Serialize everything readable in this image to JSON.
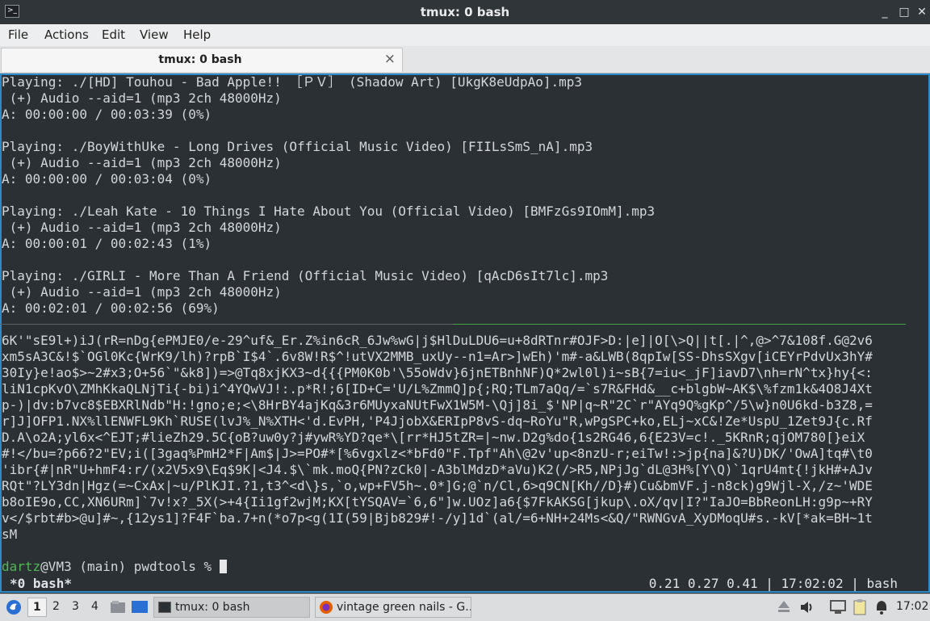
{
  "window": {
    "title": "tmux: 0 bash",
    "minimize": "_",
    "maximize": "□",
    "close": "✕"
  },
  "menu": [
    "File",
    "Actions",
    "Edit",
    "View",
    "Help"
  ],
  "tab": {
    "title": "tmux: 0 bash",
    "close": "×"
  },
  "terminal": {
    "output": "Playing: ./[HD] Touhou - Bad Apple!! ［ＰＶ］ (Shadow Art) [UkgK8eUdpAo].mp3\n (+) Audio --aid=1 (mp3 2ch 48000Hz)\nA: 00:00:00 / 00:03:39 (0%)\n\nPlaying: ./BoyWithUke - Long Drives (Official Music Video) [FIILsSmS_nA].mp3\n (+) Audio --aid=1 (mp3 2ch 48000Hz)\nA: 00:00:00 / 00:03:04 (0%)\n\nPlaying: ./Leah Kate - 10 Things I Hate About You (Official Video) [BMFzGs9IOmM].mp3\n (+) Audio --aid=1 (mp3 2ch 48000Hz)\nA: 00:00:01 / 00:02:43 (1%)\n\nPlaying: ./GIRLI - More Than A Friend (Official Music Video) [qAcD6sIt7lc].mp3\n (+) Audio --aid=1 (mp3 2ch 48000Hz)\nA: 00:02:01 / 00:02:56 (69%)",
    "random": "6K'\"sE9l+)iJ(rR=nDg{ePMJE0/e-29^uf&_Er.Z%in6cR_6Jw%wG|j$HlDuLDU6=u+8dRTnr#OJF>D:|e]|O[\\>Q||t[.|^,@>^7&108f.G@2v6\nxm5sA3C&!$`OGl0Kc{WrK9/lh)?rpB`I$4`.6v8W!R$^!utVX2MMB_uxUy--n1=Ar>]wEh)'m#-a&LWB(8qpIw[SS-DhsSXgv[iCEYrPdvUx3hY#\n30Iy}e!ao$>~2#x3;O+56`\"&k8])=>@Tq8xjKX3~d{{{PM0K0b'\\55oWdv}6jnETBnhNF)Q*2wl0l)i~sB{7=iu<_jF]iavD7\\nh=rN^tx}hy{<:\nliN1cpKvO\\ZMhKkaQLNjTi{-bi)i^4YQwVJ!:.p*R!;6[ID+C='U/L%ZmmQ]p{;RQ;TLm7aQq/=`s7R&FHd&__c+blgbW~AK$\\%fzm1k&4O8J4Xt\np-)|dv:b7vc8$EBXRlNdb\"H:!gno;e;<\\8HrBY4ajKq&3r6MUyxaNUtFwX1W5M-\\Qj]8i_$'NP|q~R\"2C`r\"AYq9Q%gKp^/5\\w}n0U6kd-b3Z8,=\nr]J]OFP1.NX%llENWFL9Kh`RUSE(lvJ%_N%XTH<'d.EvPH,'P4JjobX&ERIpP8vS-dq~RoYu\"R,wPgSPC+ko,ELj~xC&!Ze*UspU_1Zet9J{c.Rf\nD.A\\o2A;yl6x<^EJT;#lieZh29.5C{oB?uw0y?j#ywR%YD?qe*\\[rr*HJ5tZR=|~nw.D2g%do{1s2RG46,6{E23V=c!._5KRnR;qjOM780[}eiX\n#!</bu=?p66?2\"EV;i([3gaq%PmH2*F|Am$|J>=PO#*[%6vgxlz<*bFd0\"F.Tpf\"Ah\\@2v'up<8nzU-r;eiTw!:>jp{na]&?U)DK/'OwA]tq#\\t0\n'ibr{#|nR\"U+hmF4:r/(x2V5x9\\Eq$9K|<J4.$\\`mk.moQ{PN?zCk0|-A3blMdzD*aVu)K2(/>R5,NPjJg`dL@3H%[Y\\Q)`1qrU4mt{!jkH#+AJv\nRQt\"?LY3dn|Hgz(=~CxAx|~u/PlKJI.?1,t3^<d\\}s,`o,wp+FV5h~.0*]G;@`n/Cl,6>q9CN[Kh//D}#)Cu&bmVF.j-n8ck)g9Wjl-X,/z~'WDE\nb8oIE9o,CC,XN6URm]`7v!x?_5X(>+4{Ii1gf2wjM;KX[tYSQAV=`6,6\"]w.UOz]a6{$7FkAKSG[jkup\\.oX/qv|I?\"IaJO=BbReonLH:g9p~+RY\nv</$rbt#b>@u]#~,{12ys1]?F4F`ba.7+n(*o7p<g(1I(59|Bjb829#!-/y]1d`(al/=6+NH+24Ms<&Q/\"RWNGvA_XyDMoqU#s.-kV[*ak=BH~1t\nsM",
    "prompt_user": "dartz",
    "prompt_rest": "@VM3 (main) pwdtools % "
  },
  "status": {
    "window": "*0 bash*",
    "right": "0.21 0.27 0.41 | 17:02:02 | bash"
  },
  "panel": {
    "workspaces": [
      "1",
      "2",
      "3",
      "4"
    ],
    "task1": "tmux: 0 bash",
    "task2": "vintage green nails - G...",
    "clock": "17:02"
  }
}
